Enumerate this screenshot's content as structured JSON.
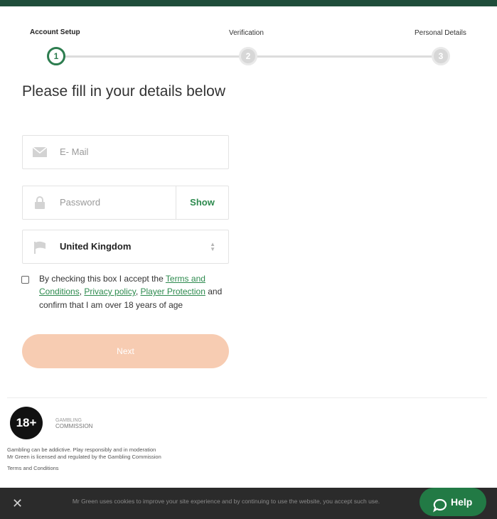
{
  "stepper": {
    "steps": [
      {
        "label": "Account Setup",
        "number": "1",
        "state": "active"
      },
      {
        "label": "Verification",
        "number": "2",
        "state": "inactive"
      },
      {
        "label": "Personal Details",
        "number": "3",
        "state": "inactive"
      }
    ]
  },
  "form": {
    "heading": "Please fill in your details below",
    "email_placeholder": "E- Mail",
    "password_placeholder": "Password",
    "show_label": "Show",
    "country_value": "United Kingdom",
    "terms": {
      "prefix": "By checking this box I accept the ",
      "link1": "Terms and Conditions",
      "sep1": ", ",
      "link2": "Privacy policy",
      "sep2": ", ",
      "link3": "Player Protection",
      "suffix": " and confirm that I am over 18 years of age"
    },
    "next_label": "Next"
  },
  "footer": {
    "age_badge": "18+",
    "gc_line1": "GAMBLING",
    "gc_line2": "COMMISSION",
    "line1": "Gambling can be addictive. Play responsibly and in moderation",
    "line2": "Mr Green is licensed and regulated by the Gambling Commission",
    "line3": "Terms and Conditions"
  },
  "cookie": {
    "close_symbol": "✕",
    "text": "Mr Green uses cookies to improve your site experience and by continuing to use the website, you accept such use."
  },
  "help": {
    "label": "Help"
  },
  "colors": {
    "brand_green": "#2d7d4f",
    "top_bar": "#1f4d3a",
    "next_button": "#f7ccb2",
    "help_button": "#227a45",
    "cookie_bar": "#2b2b2b"
  }
}
